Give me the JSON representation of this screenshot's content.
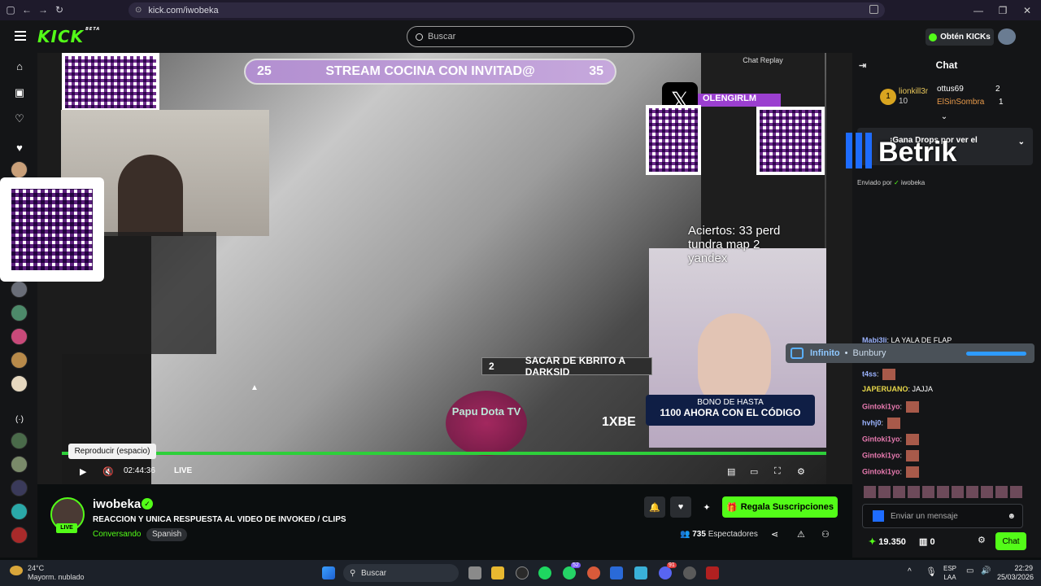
{
  "browser": {
    "url": "kick.com/iwobeka"
  },
  "header": {
    "logo": "KICK",
    "logo_badge": "BETA",
    "search_placeholder": "Buscar",
    "get_kicks": "Obtén KICKs"
  },
  "video": {
    "banner_left": "25",
    "banner_title": "STREAM COCINA CON INVITAD@",
    "banner_right": "35",
    "olen_tag": "OLENGIRLM",
    "chat_replay_title": "Chat Replay",
    "overlay_text": [
      "Aciertos: 33 perd",
      "tundra map 2",
      "yandex"
    ],
    "sacar_num": "2",
    "sacar_text": "SACAR DE KBRITO A DARKSID",
    "bono_line1": "BONO DE HASTA",
    "bono_line2": "1100 AHORA CON EL CÓDIGO",
    "onexbet": "1XBE",
    "papu": "Papu Dota TV",
    "tooltip": "Reproducir (espacio)",
    "time": "02:44:36",
    "live": "LIVE"
  },
  "stream": {
    "name": "iwobeka",
    "live_badge": "LIVE",
    "title": "REACCION Y UNICA RESPUESTA AL VIDEO DE INVOKED / CLIPS",
    "category": "Conversando",
    "language": "Spanish",
    "subscribe_label": "Regala Suscripciones",
    "viewers_count": "735",
    "viewers_label": "Espectadores"
  },
  "chat": {
    "title": "Chat",
    "leader1_name": "lionkill3r",
    "leader1_count": "10",
    "leader2_name": "ottus69",
    "leader2_count": "2",
    "leader3_name": "ElSinSombra",
    "leader3_count": "1",
    "drops_text": "¡Gana Drops por ver el",
    "betrik": "Betrik",
    "pinned_text": "Enviado por",
    "pinned_user": "iwobeka",
    "music_service": "Infinito",
    "music_track": "Bunbury",
    "messages": [
      {
        "user": "Mabi3li",
        "text": "LA YALA DE FLAP"
      },
      {
        "user": "t4ss",
        "text": ""
      },
      {
        "user": "JAPERUANO",
        "text": "JAJJA"
      },
      {
        "user": "Gintoki1yo",
        "text": ""
      },
      {
        "user": "hvhj0",
        "text": ""
      },
      {
        "user": "Gintoki1yo",
        "text": ""
      },
      {
        "user": "Gintoki1yo",
        "text": ""
      },
      {
        "user": "Gintoki1yo",
        "text": ""
      }
    ],
    "input_placeholder": "Enviar un mensaje",
    "kicks_count": "19.350",
    "zero_count": "0",
    "chat_button": "Chat"
  },
  "taskbar": {
    "temp": "24°C",
    "weather": "Mayorm. nublado",
    "search": "Buscar",
    "lang1": "ESP",
    "lang2": "LAA",
    "time": "22:29",
    "date": "25/03/2026",
    "badge1": "52",
    "badge2": "91"
  }
}
